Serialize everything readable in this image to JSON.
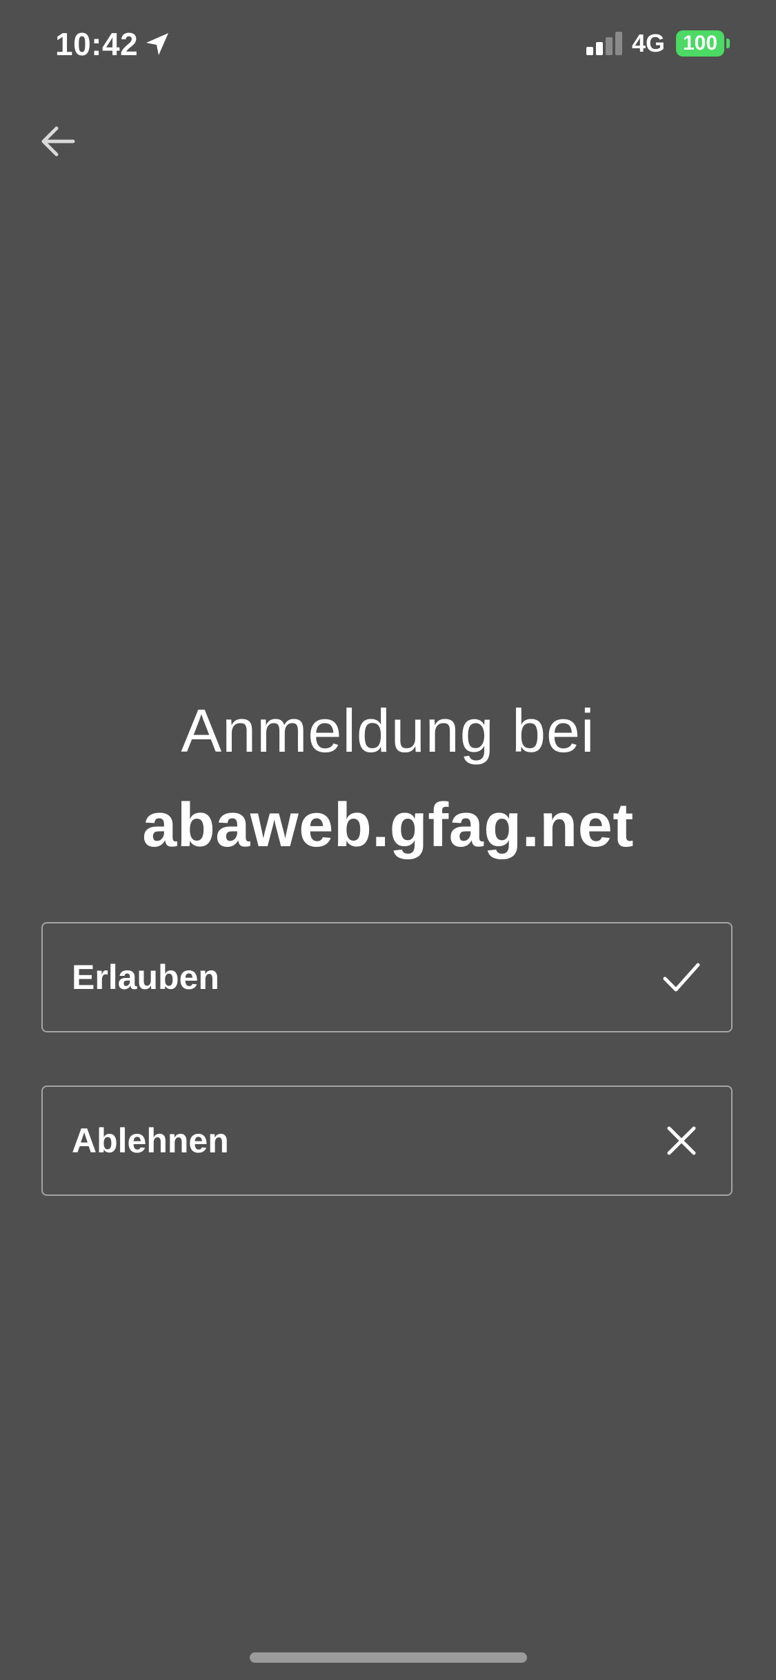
{
  "status_bar": {
    "time": "10:42",
    "network": "4G",
    "battery": "100",
    "battery_color": "#4cd964",
    "icons": [
      "location-arrow-icon",
      "cellular-signal-icon"
    ]
  },
  "navigation": {
    "back_icon": "arrow-left-icon"
  },
  "header": {
    "prefix": "Anmeldung bei",
    "domain": "abaweb.gfag.net"
  },
  "actions": {
    "allow": {
      "label": "Erlauben",
      "icon": "checkmark-icon"
    },
    "deny": {
      "label": "Ablehnen",
      "icon": "close-icon"
    }
  },
  "colors": {
    "background": "#4f4f4f",
    "text": "#ffffff",
    "button_border": "#a5a5a5",
    "home_indicator": "#9b9b9b"
  }
}
